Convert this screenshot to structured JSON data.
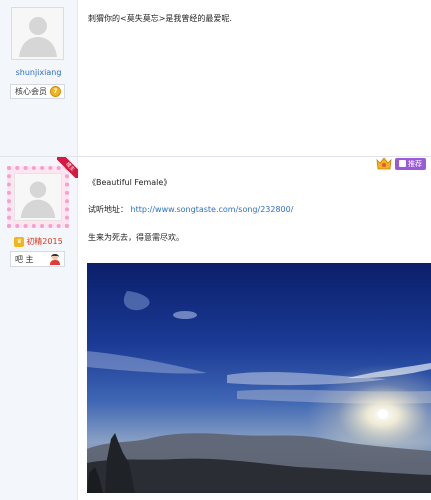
{
  "post1": {
    "username": "shunjixiang",
    "badge_label": "核心会员",
    "level": "7",
    "content": "刺猬你的<莫失莫忘>是我曾经的最爱呢."
  },
  "post2": {
    "ribbon_text": "楼主",
    "user_title": "初精2015",
    "badge_label": "吧 主",
    "recommend_label": "推荐",
    "song_title": "《Beautiful Female》",
    "listen_label": "试听地址：",
    "listen_url": "http://www.songtaste.com/song/232800/",
    "quote": "生来为死去，得意需尽欢。"
  },
  "colors": {
    "link": "#2f6fc8",
    "title_red": "#e03b1d",
    "recommend_purple": "#9b5bd7",
    "frame_pink": "#f6a0ce"
  }
}
